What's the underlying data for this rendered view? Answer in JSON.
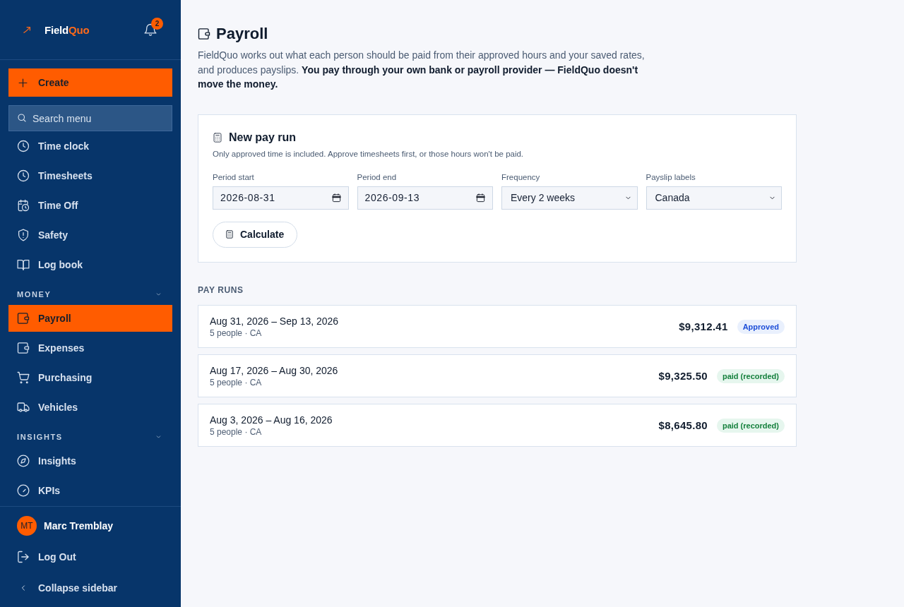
{
  "sidebar": {
    "brand": {
      "main": "Field",
      "accent": "Quo"
    },
    "notifications": {
      "count": "2"
    },
    "create_button": {
      "label": "Create"
    },
    "search": {
      "placeholder": "Search menu"
    },
    "nav_groups": [
      {
        "items": [
          {
            "label": "Time clock",
            "selected": false
          },
          {
            "label": "Timesheets",
            "selected": false
          },
          {
            "label": "Time Off",
            "selected": false
          },
          {
            "label": "Safety",
            "selected": false
          },
          {
            "label": "Log book",
            "selected": false
          }
        ]
      },
      {
        "heading": "MONEY",
        "expanded": true,
        "items": [
          {
            "label": "Payroll",
            "selected": true
          },
          {
            "label": "Expenses",
            "selected": false
          },
          {
            "label": "Purchasing",
            "selected": false
          },
          {
            "label": "Vehicles",
            "selected": false
          }
        ]
      },
      {
        "heading": "INSIGHTS",
        "expanded": true,
        "items": [
          {
            "label": "Insights",
            "selected": false
          },
          {
            "label": "KPIs",
            "selected": false
          }
        ]
      }
    ],
    "user": {
      "initials": "MT",
      "name": "Marc Tremblay"
    },
    "footer_actions": [
      {
        "kind": "logout",
        "label": "Log Out"
      },
      {
        "kind": "collapse",
        "label": "Collapse sidebar"
      }
    ]
  },
  "page": {
    "title": "Payroll",
    "description": "FieldQuo works out what each person should be paid from their approved hours and your saved rates, and produces payslips. **You pay through your own bank or payroll provider — FieldQuo doesn't move the money.**"
  },
  "new_pay_run": {
    "title": "New pay run",
    "note": "Only approved time is included. Approve timesheets first, or those hours won't be paid.",
    "fields": [
      {
        "kind": "date",
        "label": "Period start",
        "value": "2026-08-31"
      },
      {
        "kind": "date",
        "label": "Period end",
        "value": "2026-09-13"
      },
      {
        "kind": "select",
        "label": "Frequency",
        "value": "Every 2 weeks"
      },
      {
        "kind": "select",
        "label": "Payslip labels",
        "value": "Canada"
      }
    ],
    "button": {
      "label": "Calculate"
    }
  },
  "pay_runs": {
    "heading": "PAY RUNS",
    "rows": [
      {
        "period": "Aug 31, 2026 – Sep 13, 2026",
        "details": "5 people · CA",
        "amount": "$9,312.41",
        "status": {
          "kind": "approved",
          "label": "Approved"
        }
      },
      {
        "period": "Aug 17, 2026 – Aug 30, 2026",
        "details": "5 people · CA",
        "amount": "$9,325.50",
        "status": {
          "kind": "paid",
          "label": "paid (recorded)"
        }
      },
      {
        "period": "Aug 3, 2026 – Aug 16, 2026",
        "details": "5 people · CA",
        "amount": "$8,645.80",
        "status": {
          "kind": "paid",
          "label": "paid (recorded)"
        }
      }
    ]
  }
}
